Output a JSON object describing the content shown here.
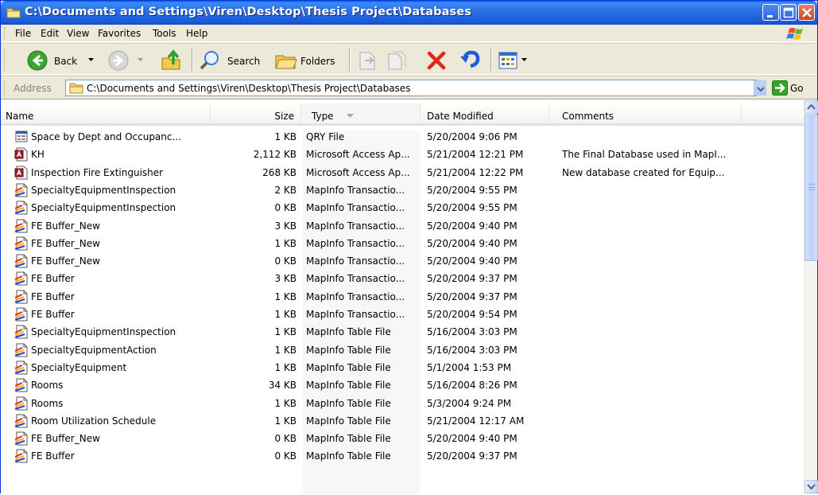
{
  "window": {
    "title": "C:\\Documents and Settings\\Viren\\Desktop\\Thesis Project\\Databases"
  },
  "menu": {
    "items": [
      "File",
      "Edit",
      "View",
      "Favorites",
      "Tools",
      "Help"
    ]
  },
  "toolbar": {
    "back_label": "Back",
    "search_label": "Search",
    "folders_label": "Folders"
  },
  "address": {
    "label": "Address",
    "value": "C:\\Documents and Settings\\Viren\\Desktop\\Thesis Project\\Databases",
    "go_label": "Go"
  },
  "columns": {
    "name": "Name",
    "size": "Size",
    "type": "Type",
    "date": "Date Modified",
    "comments": "Comments"
  },
  "files": [
    {
      "name": "Space by Dept and Occupanc...",
      "size": "1 KB",
      "type": "QRY File",
      "date": "5/20/2004 9:06 PM",
      "comments": "",
      "icon": "qry-file-icon"
    },
    {
      "name": "KH",
      "size": "2,112 KB",
      "type": "Microsoft Access Ap...",
      "date": "5/21/2004 12:21 PM",
      "comments": "The Final Database used in MapI...",
      "icon": "access-file-icon"
    },
    {
      "name": "Inspection Fire Extinguisher",
      "size": "268 KB",
      "type": "Microsoft Access Ap...",
      "date": "5/21/2004 12:22 PM",
      "comments": "New database created for Equip...",
      "icon": "access-file-icon"
    },
    {
      "name": "SpecialtyEquipmentInspection",
      "size": "2 KB",
      "type": "MapInfo Transactio...",
      "date": "5/20/2004 9:55 PM",
      "comments": "",
      "icon": "mapinfo-file-icon"
    },
    {
      "name": "SpecialtyEquipmentInspection",
      "size": "0 KB",
      "type": "MapInfo Transactio...",
      "date": "5/20/2004 9:55 PM",
      "comments": "",
      "icon": "mapinfo-file-icon"
    },
    {
      "name": "FE Buffer_New",
      "size": "3 KB",
      "type": "MapInfo Transactio...",
      "date": "5/20/2004 9:40 PM",
      "comments": "",
      "icon": "mapinfo-file-icon"
    },
    {
      "name": "FE Buffer_New",
      "size": "1 KB",
      "type": "MapInfo Transactio...",
      "date": "5/20/2004 9:40 PM",
      "comments": "",
      "icon": "mapinfo-file-icon"
    },
    {
      "name": "FE Buffer_New",
      "size": "0 KB",
      "type": "MapInfo Transactio...",
      "date": "5/20/2004 9:40 PM",
      "comments": "",
      "icon": "mapinfo-file-icon"
    },
    {
      "name": "FE Buffer",
      "size": "3 KB",
      "type": "MapInfo Transactio...",
      "date": "5/20/2004 9:37 PM",
      "comments": "",
      "icon": "mapinfo-file-icon"
    },
    {
      "name": "FE Buffer",
      "size": "1 KB",
      "type": "MapInfo Transactio...",
      "date": "5/20/2004 9:37 PM",
      "comments": "",
      "icon": "mapinfo-file-icon"
    },
    {
      "name": "FE Buffer",
      "size": "1 KB",
      "type": "MapInfo Transactio...",
      "date": "5/20/2004 9:54 PM",
      "comments": "",
      "icon": "mapinfo-file-icon"
    },
    {
      "name": "SpecialtyEquipmentInspection",
      "size": "1 KB",
      "type": "MapInfo Table File",
      "date": "5/16/2004 3:03 PM",
      "comments": "",
      "icon": "mapinfo-file-icon"
    },
    {
      "name": "SpecialtyEquipmentAction",
      "size": "1 KB",
      "type": "MapInfo Table File",
      "date": "5/16/2004 3:03 PM",
      "comments": "",
      "icon": "mapinfo-file-icon"
    },
    {
      "name": "SpecialtyEquipment",
      "size": "1 KB",
      "type": "MapInfo Table File",
      "date": "5/1/2004 1:53 PM",
      "comments": "",
      "icon": "mapinfo-file-icon"
    },
    {
      "name": "Rooms",
      "size": "34 KB",
      "type": "MapInfo Table File",
      "date": "5/16/2004 8:26 PM",
      "comments": "",
      "icon": "mapinfo-file-icon"
    },
    {
      "name": "Rooms",
      "size": "1 KB",
      "type": "MapInfo Table File",
      "date": "5/3/2004 9:24 PM",
      "comments": "",
      "icon": "mapinfo-file-icon"
    },
    {
      "name": "Room Utilization Schedule",
      "size": "1 KB",
      "type": "MapInfo Table File",
      "date": "5/21/2004 12:17 AM",
      "comments": "",
      "icon": "mapinfo-file-icon"
    },
    {
      "name": "FE Buffer_New",
      "size": "0 KB",
      "type": "MapInfo Table File",
      "date": "5/20/2004 9:40 PM",
      "comments": "",
      "icon": "mapinfo-file-icon"
    },
    {
      "name": "FE Buffer",
      "size": "0 KB",
      "type": "MapInfo Table File",
      "date": "5/20/2004 9:37 PM",
      "comments": "",
      "icon": "mapinfo-file-icon"
    }
  ]
}
